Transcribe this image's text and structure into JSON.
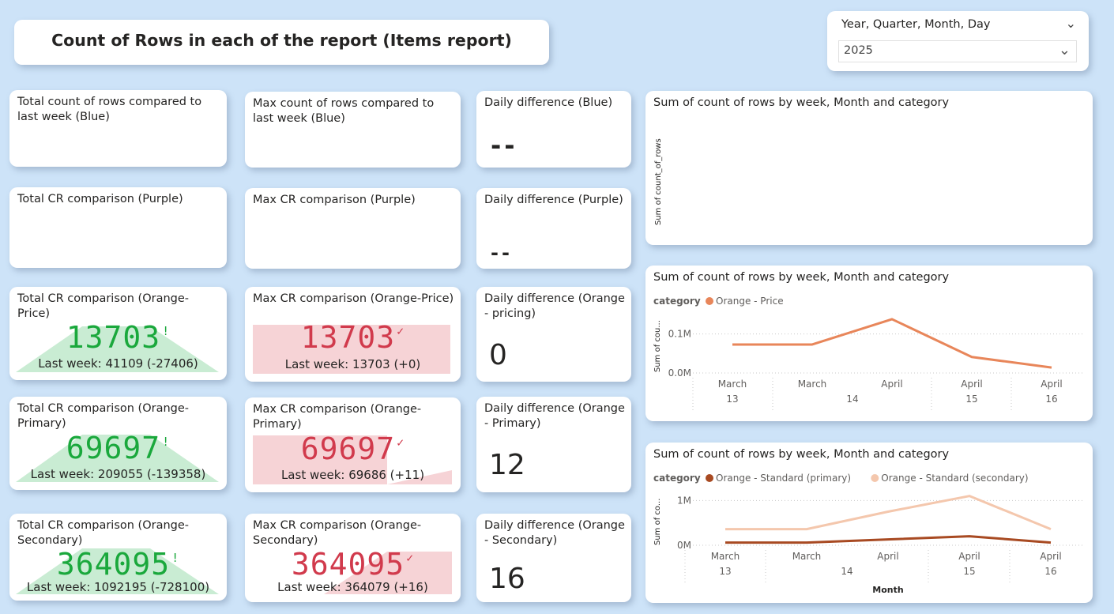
{
  "page_title": "Count of Rows in each of the report (Items report)",
  "slicer": {
    "label": "Year, Quarter, Month, Day",
    "value": "2025"
  },
  "cards": {
    "total_blue": "Total count of rows compared to last week (Blue)",
    "max_blue": "Max count of rows compared to last week (Blue)",
    "daily_blue": {
      "title": "Daily difference (Blue)",
      "value": "--"
    },
    "total_purple": "Total CR comparison (Purple)",
    "max_purple": "Max CR comparison (Purple)",
    "daily_purple": {
      "title": "Daily difference (Purple)",
      "value": "--"
    },
    "total_price": {
      "title": "Total CR comparison (Orange-Price)",
      "value": "13703",
      "mark": "!",
      "last": "Last week: 41109 (-27406)"
    },
    "max_price": {
      "title": "Max CR comparison (Orange-Price)",
      "value": "13703",
      "mark": "✓",
      "last": "Last week: 13703 (+0)"
    },
    "daily_price": {
      "title": "Daily difference (Orange - pricing)",
      "value": "0"
    },
    "total_primary": {
      "title": "Total CR comparison (Orange-Primary)",
      "value": "69697",
      "mark": "!",
      "last": "Last week: 209055 (-139358)"
    },
    "max_primary": {
      "title": "Max CR comparison (Orange-Primary)",
      "value": "69697",
      "mark": "✓",
      "last": "Last week: 69686 (+11)"
    },
    "daily_primary": {
      "title": "Daily difference (Orange - Primary)",
      "value": "12"
    },
    "total_secondary": {
      "title": "Total CR comparison (Orange-Secondary)",
      "value": "364095",
      "mark": "!",
      "last": "Last week: 1092195 (-728100)"
    },
    "max_secondary": {
      "title": "Max CR comparison (Orange-Secondary)",
      "value": "364095",
      "mark": "✓",
      "last": "Last week: 364079 (+16)"
    },
    "daily_secondary": {
      "title": "Daily difference (Orange - Secondary)",
      "value": "16"
    }
  },
  "colors": {
    "green": "#1aa83c",
    "red": "#d13a4c",
    "green_fill": "#c9ecd3",
    "red_fill": "#f6d3d6",
    "price": "#e8865a",
    "primary": "#a84a22",
    "secondary": "#f4c7ad"
  },
  "chart_data": [
    {
      "type": "line",
      "title": "Sum of count of rows by week, Month and category",
      "ylabel": "Sum of count_of_rows",
      "series": []
    },
    {
      "type": "line",
      "title": "Sum of count of rows by week, Month and category",
      "legend_title": "category",
      "ylabel": "Sum of cou...",
      "x": [
        "March",
        "March",
        "April",
        "April",
        "April"
      ],
      "x_groups": [
        "13",
        "14",
        "15",
        "16"
      ],
      "y_ticks": [
        "0.1M",
        "0.0M"
      ],
      "ylim": [
        0,
        0.15
      ],
      "series": [
        {
          "name": "Orange - Price",
          "values": [
            0.073,
            0.073,
            0.138,
            0.041,
            0.014
          ]
        }
      ]
    },
    {
      "type": "line",
      "title": "Sum of count of rows by week, Month and category",
      "legend_title": "category",
      "ylabel": "Sum of co...",
      "xlabel": "Month",
      "x": [
        "March",
        "March",
        "April",
        "April",
        "April"
      ],
      "x_groups": [
        "13",
        "14",
        "15",
        "16"
      ],
      "y_ticks": [
        "1M",
        "0M"
      ],
      "ylim": [
        0,
        1.2
      ],
      "series": [
        {
          "name": "Orange - Standard (primary)",
          "values": [
            0.06,
            0.06,
            0.13,
            0.2,
            0.06
          ]
        },
        {
          "name": "Orange - Standard (secondary)",
          "values": [
            0.36,
            0.36,
            0.75,
            1.1,
            0.36
          ]
        }
      ]
    }
  ]
}
